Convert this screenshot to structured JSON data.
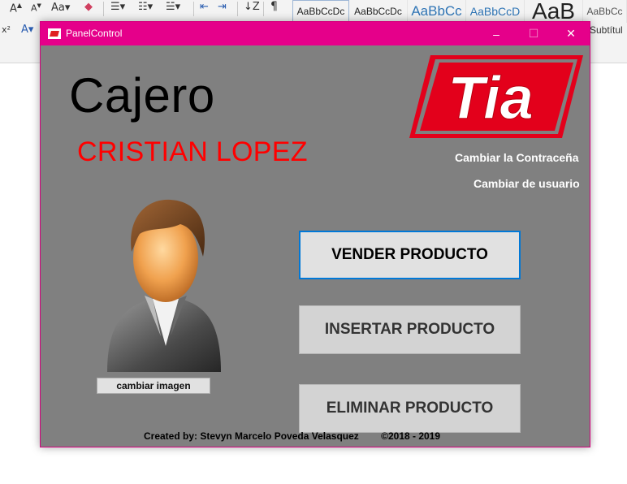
{
  "word": {
    "style_gallery": [
      "AaBbCcDc",
      "AaBbCcDc",
      "AaBbCc",
      "AaBbCcD",
      "AaB",
      "AaBbCc"
    ],
    "subtitle_style": "Subtítul",
    "icons": [
      "font-size-up-icon",
      "font-size-down-icon",
      "change-case-icon",
      "clear-formatting-icon",
      "bullets-icon",
      "numbering-icon",
      "multilevel-list-icon",
      "decrease-indent-icon",
      "increase-indent-icon",
      "sort-icon",
      "paragraph-mark-icon",
      "text-effects-icon"
    ]
  },
  "window": {
    "title": "PanelControl",
    "controls": {
      "minimize": "–",
      "maximize": "☐",
      "close": "✕"
    }
  },
  "panel": {
    "role": "Cajero",
    "user_name": "CRISTIAN LOPEZ",
    "logo_text": "Tia",
    "change_password": "Cambiar la Contraceña",
    "change_user": "Cambiar de usuario",
    "change_image": "cambiar imagen",
    "buttons": {
      "sell": "VENDER PRODUCTO",
      "insert": "INSERTAR PRODUCTO",
      "delete": "ELIMINAR PRODUCTO"
    },
    "footer": {
      "credits": "Created by: Stevyn Marcelo Poveda Velasquez",
      "years": "©2018 - 2019"
    }
  },
  "colors": {
    "titlebar": "#e5008a",
    "client_bg": "#808080",
    "user_name": "#ff0000",
    "logo_red": "#e3001b",
    "focus_border": "#0078d7"
  }
}
